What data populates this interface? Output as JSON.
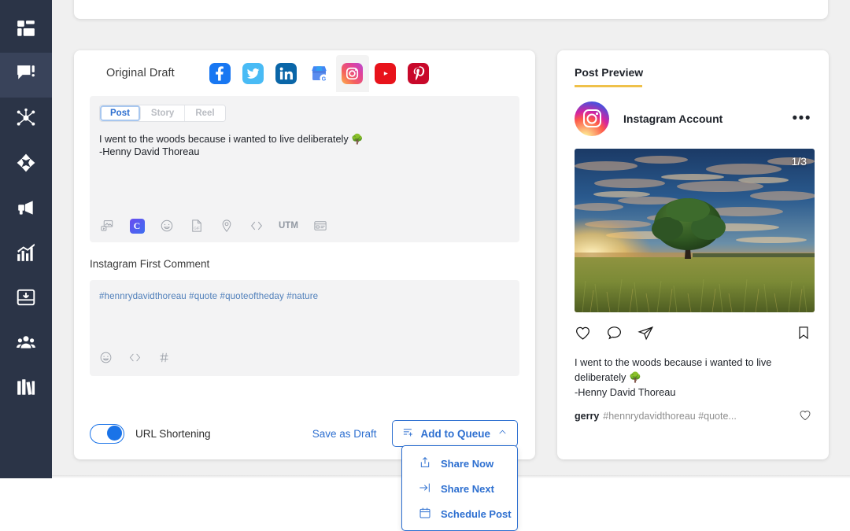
{
  "sidebar": {
    "items": [
      {
        "icon": "dashboard-icon",
        "name": "sidebar-item-dashboard",
        "active": false
      },
      {
        "icon": "engage-messages-icon",
        "name": "sidebar-item-engage",
        "active": true
      },
      {
        "icon": "network-icon",
        "name": "sidebar-item-network",
        "active": false
      },
      {
        "icon": "target-icon",
        "name": "sidebar-item-target",
        "active": false
      },
      {
        "icon": "megaphone-icon",
        "name": "sidebar-item-campaigns",
        "active": false
      },
      {
        "icon": "analytics-chart-icon",
        "name": "sidebar-item-analytics",
        "active": false
      },
      {
        "icon": "inbox-download-icon",
        "name": "sidebar-item-inbox",
        "active": false
      },
      {
        "icon": "team-people-icon",
        "name": "sidebar-item-team",
        "active": false
      },
      {
        "icon": "library-books-icon",
        "name": "sidebar-item-library",
        "active": false
      }
    ]
  },
  "composer": {
    "draft_label": "Original Draft",
    "networks": [
      {
        "name": "facebook",
        "label": "Facebook",
        "color": "#1877F2",
        "selected": false
      },
      {
        "name": "twitter",
        "label": "Twitter",
        "color": "#49BBF5",
        "selected": false
      },
      {
        "name": "linkedin",
        "label": "LinkedIn",
        "color": "#0A66A8",
        "selected": false
      },
      {
        "name": "google-business",
        "label": "Google Business Profile",
        "color": "#4285F4",
        "selected": false
      },
      {
        "name": "instagram",
        "label": "Instagram",
        "color": "#E1306C",
        "selected": true
      },
      {
        "name": "youtube",
        "label": "YouTube",
        "color": "#E8131B",
        "selected": false
      },
      {
        "name": "pinterest",
        "label": "Pinterest",
        "color": "#C8082A",
        "selected": false
      }
    ],
    "post_types": [
      {
        "label": "Post",
        "selected": true
      },
      {
        "label": "Story",
        "selected": false
      },
      {
        "label": "Reel",
        "selected": false
      }
    ],
    "post_text_line1": "I went to the woods because i wanted to live deliberately ",
    "post_text_emoji": "🌳",
    "post_text_line2": "-Henny David Thoreau",
    "tools": [
      {
        "name": "media-image-icon",
        "label": "Add media"
      },
      {
        "name": "canva-icon",
        "label": "Canva"
      },
      {
        "name": "emoji-icon",
        "label": "Emoji"
      },
      {
        "name": "gif-icon",
        "label": "GIF"
      },
      {
        "name": "location-pin-icon",
        "label": "Location"
      },
      {
        "name": "code-icon",
        "label": "Variables"
      },
      {
        "name": "utm-icon",
        "label": "UTM"
      },
      {
        "name": "card-icon",
        "label": "Link preview"
      }
    ],
    "utm_label": "UTM",
    "first_comment_title": "Instagram First Comment",
    "first_comment_text": "#hennrydavidthoreau #quote #quoteoftheday #nature",
    "first_comment_tools": [
      {
        "name": "emoji-icon",
        "label": "Emoji"
      },
      {
        "name": "code-icon",
        "label": "Variables"
      },
      {
        "name": "hashtag-icon",
        "label": "Hashtags"
      }
    ]
  },
  "footer": {
    "url_shortening_label": "URL Shortening",
    "url_shortening_on": true,
    "save_draft_label": "Save as Draft",
    "queue_label": "Add to Queue",
    "queue_chevron": "chevron-up-icon"
  },
  "dropdown": {
    "items": [
      {
        "label": "Share Now",
        "icon": "share-upload-icon"
      },
      {
        "label": "Share Next",
        "icon": "arrow-right-bar-icon"
      },
      {
        "label": "Schedule Post",
        "icon": "calendar-icon"
      }
    ]
  },
  "preview": {
    "title": "Post Preview",
    "account_name": "Instagram Account",
    "more_dots": "•••",
    "image_counter": "1/3",
    "caption_line1": "I went to the woods because i wanted to live",
    "caption_line2": "deliberately ",
    "caption_emoji": "🌳",
    "caption_line3": "-Henny David Thoreau",
    "comment_user": "gerry",
    "comment_tags": "#hennrydavidthoreau #quote...",
    "actions": [
      {
        "name": "like-heart-icon"
      },
      {
        "name": "comment-bubble-icon"
      },
      {
        "name": "share-paperplane-icon"
      },
      {
        "name": "bookmark-icon"
      }
    ]
  },
  "colors": {
    "sidebar_bg": "#2b3447",
    "accent_yellow": "#efc14a",
    "primary_blue": "#2d6fd0",
    "page_bg": "#f0f0f0"
  }
}
